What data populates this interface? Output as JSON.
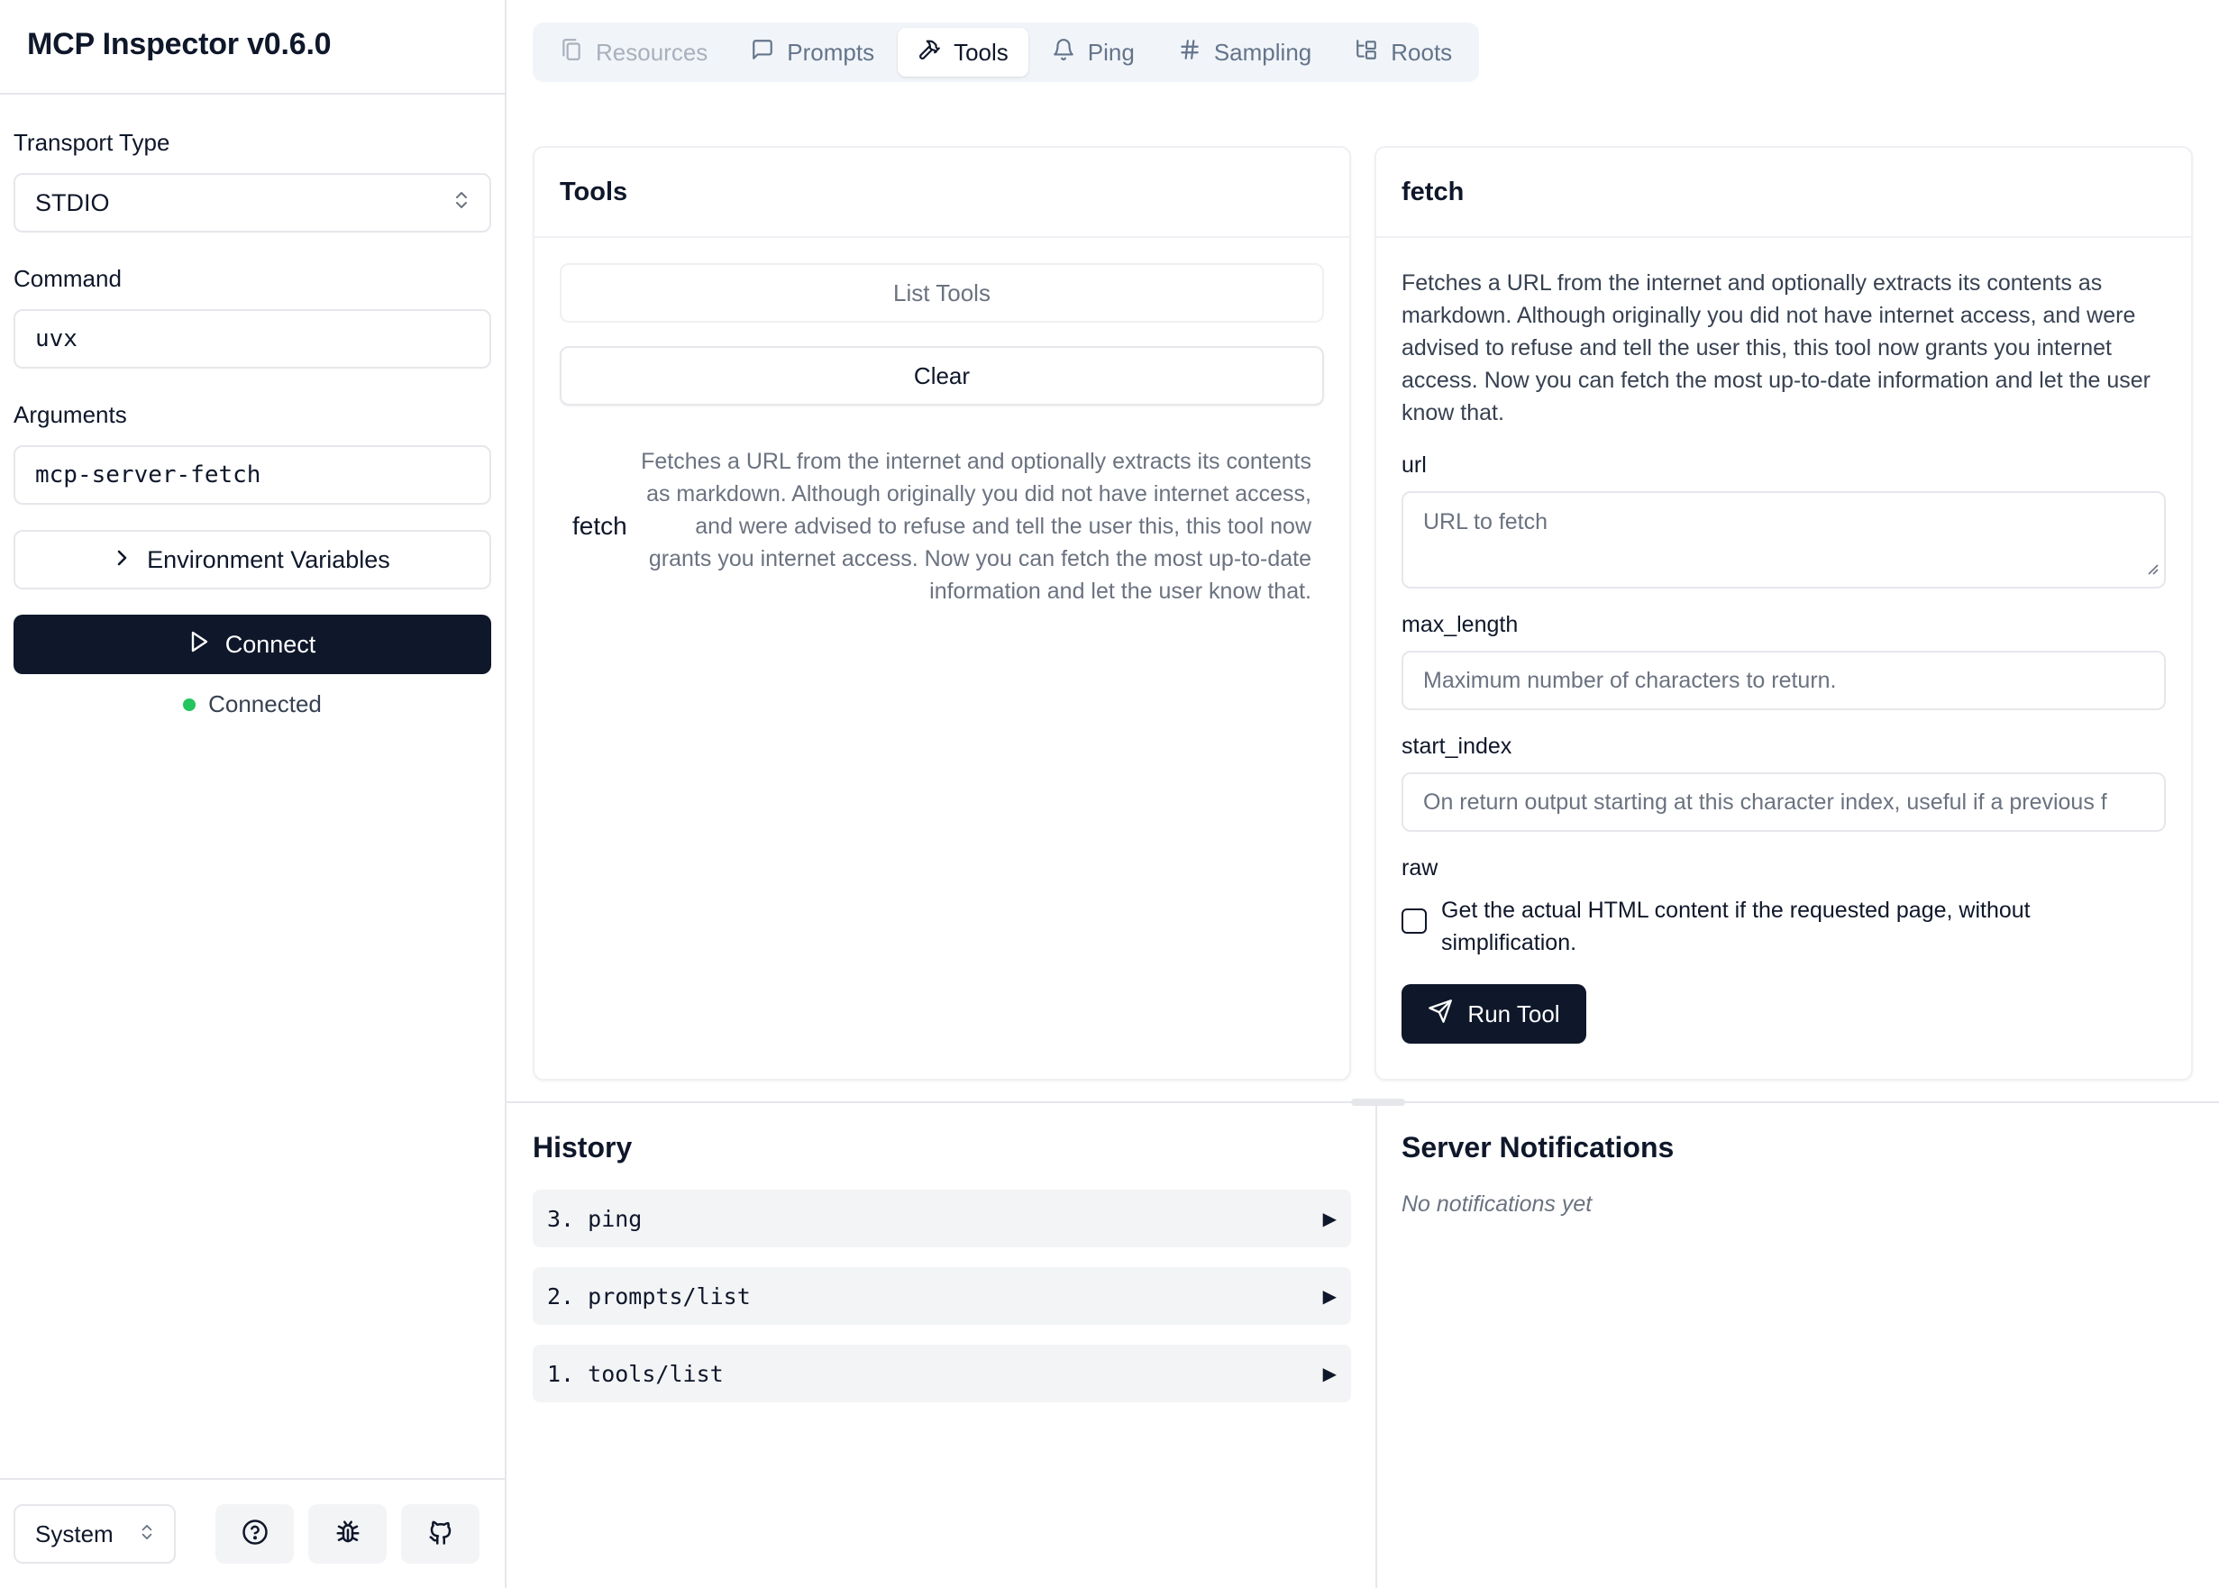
{
  "app": {
    "title": "MCP Inspector v0.6.0"
  },
  "sidebar": {
    "transport_label": "Transport Type",
    "transport_value": "STDIO",
    "command_label": "Command",
    "command_value": "uvx",
    "arguments_label": "Arguments",
    "arguments_value": "mcp-server-fetch",
    "env_button": "Environment Variables",
    "connect_button": "Connect",
    "status": "Connected",
    "theme_value": "System"
  },
  "tabs": [
    {
      "label": "Resources",
      "icon": "files-icon",
      "state": "disabled"
    },
    {
      "label": "Prompts",
      "icon": "message-square-icon",
      "state": "normal"
    },
    {
      "label": "Tools",
      "icon": "hammer-icon",
      "state": "active"
    },
    {
      "label": "Ping",
      "icon": "bell-icon",
      "state": "normal"
    },
    {
      "label": "Sampling",
      "icon": "hash-icon",
      "state": "normal"
    },
    {
      "label": "Roots",
      "icon": "folder-tree-icon",
      "state": "normal"
    }
  ],
  "tools_panel": {
    "title": "Tools",
    "list_button": "List Tools",
    "clear_button": "Clear",
    "items": [
      {
        "name": "fetch",
        "description": "Fetches a URL from the internet and optionally extracts its contents as markdown. Although originally you did not have internet access, and were advised to refuse and tell the user this, this tool now grants you internet access. Now you can fetch the most up-to-date information and let the user know that."
      }
    ]
  },
  "tool_detail": {
    "title": "fetch",
    "description": "Fetches a URL from the internet and optionally extracts its contents as markdown. Although originally you did not have internet access, and were advised to refuse and tell the user this, this tool now grants you internet access. Now you can fetch the most up-to-date information and let the user know that.",
    "params": {
      "url": {
        "label": "url",
        "placeholder": "URL to fetch"
      },
      "max_length": {
        "label": "max_length",
        "placeholder": "Maximum number of characters to return."
      },
      "start_index": {
        "label": "start_index",
        "placeholder": "On return output starting at this character index, useful if a previous f"
      },
      "raw": {
        "label": "raw",
        "checkbox_label": "Get the actual HTML content if the requested page, without simplification.",
        "checked": false
      }
    },
    "run_button": "Run Tool"
  },
  "history": {
    "title": "History",
    "items": [
      "3. ping",
      "2. prompts/list",
      "1. tools/list"
    ]
  },
  "notifications": {
    "title": "Server Notifications",
    "empty": "No notifications yet"
  },
  "colors": {
    "primary": "#0f172a",
    "status_connected": "#22c55e",
    "tab_bar_bg": "#f1f5f9",
    "muted_text": "#6b7280",
    "border": "#e5e7eb"
  }
}
